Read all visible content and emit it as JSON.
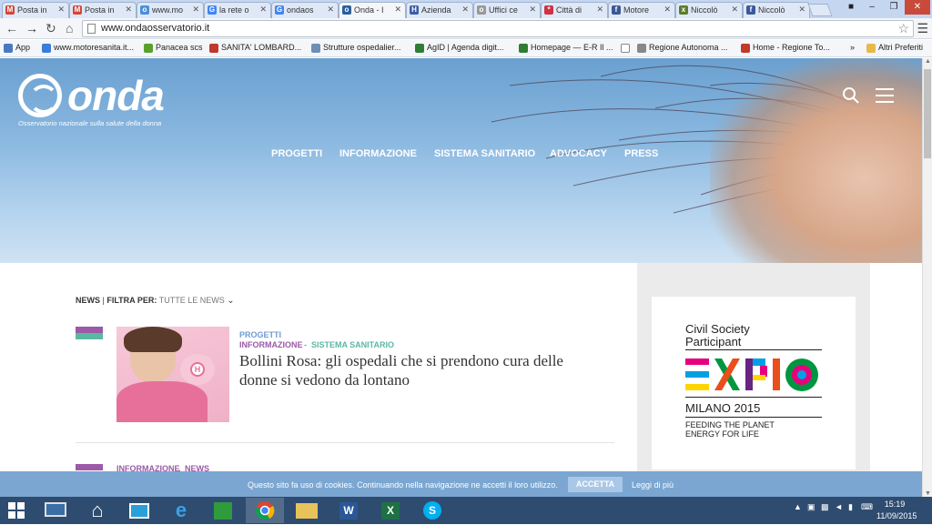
{
  "browser": {
    "tabs": [
      {
        "label": "Posta in",
        "icon": "gmail-icon",
        "color": "#d44638",
        "glyph": "M"
      },
      {
        "label": "Posta in",
        "icon": "gmail-icon",
        "color": "#d44638",
        "glyph": "M"
      },
      {
        "label": "www.mo",
        "icon": "globe-icon",
        "color": "#4a90d9",
        "glyph": "o"
      },
      {
        "label": "la rete o",
        "icon": "google-icon",
        "color": "#4285f4",
        "glyph": "G"
      },
      {
        "label": "ondaos",
        "icon": "google-icon",
        "color": "#4285f4",
        "glyph": "G"
      },
      {
        "label": "Onda - I",
        "icon": "onda-icon",
        "color": "#2a5f9e",
        "glyph": "o"
      },
      {
        "label": "Azienda",
        "icon": "h-icon",
        "color": "#3b5da8",
        "glyph": "H"
      },
      {
        "label": "Uffici ce",
        "icon": "loading-icon",
        "color": "#999999",
        "glyph": "o"
      },
      {
        "label": "Città di",
        "icon": "flower-icon",
        "color": "#cc3344",
        "glyph": "*"
      },
      {
        "label": "Motore",
        "icon": "facebook-icon",
        "color": "#3b5998",
        "glyph": "f"
      },
      {
        "label": "Niccolò",
        "icon": "puzzle-icon",
        "color": "#5a7d2a",
        "glyph": "x"
      },
      {
        "label": "Niccolò",
        "icon": "facebook-icon",
        "color": "#3b5998",
        "glyph": "f"
      }
    ],
    "active_tab": 5,
    "url": "www.ondaosservatorio.it",
    "bookmarks": [
      {
        "label": "App",
        "color": "#4a78c2"
      },
      {
        "label": "www.motoresanita.it...",
        "color": "#3b7dd8"
      },
      {
        "label": "Panacea scs",
        "color": "#5aa02c"
      },
      {
        "label": "SANITA' LOMBARD...",
        "color": "#c0392b"
      },
      {
        "label": "Strutture ospedalier...",
        "color": "#6b8fb5"
      },
      {
        "label": "AgID | Agenda digit...",
        "color": "#2e7d32"
      },
      {
        "label": "Homepage — E-R Il ...",
        "color": "#2e7d32"
      },
      {
        "label": "",
        "color": "#ffffff"
      },
      {
        "label": "Regione Autonoma ...",
        "color": "#888888"
      },
      {
        "label": "Home - Regione To...",
        "color": "#c0392b"
      },
      {
        "label": "»",
        "color": ""
      },
      {
        "label": "Altri Preferiti",
        "color": "#e8b84a"
      }
    ]
  },
  "site": {
    "logo_text": "onda",
    "logo_sub": "Osservatorio nazionale sulla salute della donna",
    "nav": [
      "PROGETTI",
      "INFORMAZIONE",
      "SISTEMA SANITARIO",
      "ADVOCACY",
      "PRESS"
    ],
    "filter": {
      "label": "NEWS",
      "filter_label": "FILTRA PER:",
      "filter_value": "TUTTE LE NEWS"
    },
    "article": {
      "tags_line1": "PROGETTI",
      "tags_line2a": "INFORMAZIONE",
      "tags_sep": "-",
      "tags_line2b": "SISTEMA SANITARIO",
      "title": "Bollini Rosa: gli ospedali che si prendono cura delle donne si vedono da lontano",
      "thumb_badge": "H"
    },
    "next_article_tags": {
      "a": "INFORMAZIONE",
      "sep": ",",
      "b": "NEWS"
    },
    "expo": {
      "line1": "Civil Society",
      "line2": "Participant",
      "brand": "EXPO",
      "city": "MILANO 2015",
      "slogan1": "FEEDING THE PLANET",
      "slogan2": "ENERGY FOR LIFE"
    },
    "colors": {
      "purple": "#9b59a8",
      "teal": "#5ab8a2",
      "blue_tag": "#6f9bd1"
    }
  },
  "cookie": {
    "message": "Questo sito fa uso di cookies. Continuando nella navigazione ne accetti il loro utilizzo.",
    "accept": "ACCETTA",
    "more": "Leggi di più"
  },
  "taskbar": {
    "time": "15:19",
    "date": "11/09/2015"
  }
}
